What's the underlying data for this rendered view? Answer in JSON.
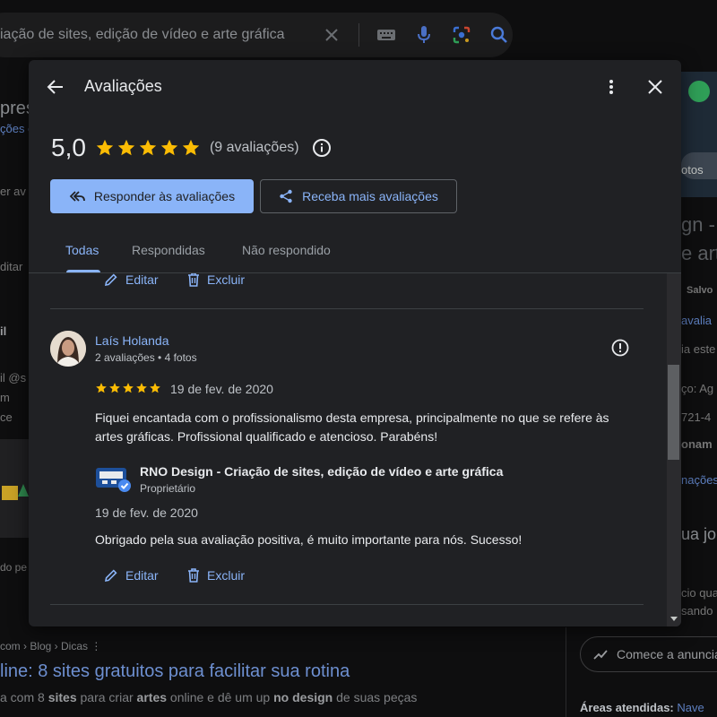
{
  "background": {
    "search_query": "iação de sites, edição de vídeo e arte gráfica",
    "left_fragments": [
      "pres",
      "ções d",
      "er av",
      "ditar",
      "il",
      "il @s",
      "m",
      "ce",
      "do pe"
    ],
    "right_fragments": [
      "otos",
      "gn -",
      "e art",
      "Salvo",
      "avalia",
      "ia este",
      "ço: Ag",
      "721-4",
      "onam",
      "nações",
      "ua jor",
      "cio qua",
      "sando"
    ],
    "breadcrumb": "com › Blog › Dicas  ⋮",
    "headline": "line: 8 sites gratuitos para facilitar sua rotina",
    "snippet_parts": [
      "a com 8 ",
      "sites",
      " para criar ",
      "artes",
      " online e dê um up ",
      "no design",
      " de suas peças"
    ],
    "cta_label": "Comece a anunciar",
    "areas_label": "Áreas atendidas:",
    "areas_value": "Nave"
  },
  "modal": {
    "title": "Avaliações",
    "rating_score": "5,0",
    "stars": 5,
    "rating_count": "(9 avaliações)",
    "buttons": {
      "respond": "Responder às avaliações",
      "get_more": "Receba mais avaliações"
    },
    "tabs": [
      {
        "label": "Todas",
        "active": true
      },
      {
        "label": "Respondidas",
        "active": false
      },
      {
        "label": "Não respondido",
        "active": false
      }
    ],
    "actions": {
      "edit": "Editar",
      "delete": "Excluir"
    },
    "review": {
      "reviewer_name": "Laís Holanda",
      "reviewer_meta": "2 avaliações • 4 fotos",
      "stars": 5,
      "date": "19 de fev. de 2020",
      "text": "Fiquei encantada com o profissionalismo desta empresa, principalmente no que se refere às artes gráficas. Profissional qualificado e atencioso. Parabéns!",
      "reply": {
        "owner_name": "RNO Design - Criação de sites, edição de vídeo e arte gráfica",
        "owner_role": "Proprietário",
        "date": "19 de fev. de 2020",
        "text": "Obrigado pela sua avaliação positiva, é muito importante para nós. Sucesso!"
      }
    }
  },
  "colors": {
    "accent": "#8ab4f8",
    "star": "#fbbc04",
    "surface": "#202124"
  }
}
